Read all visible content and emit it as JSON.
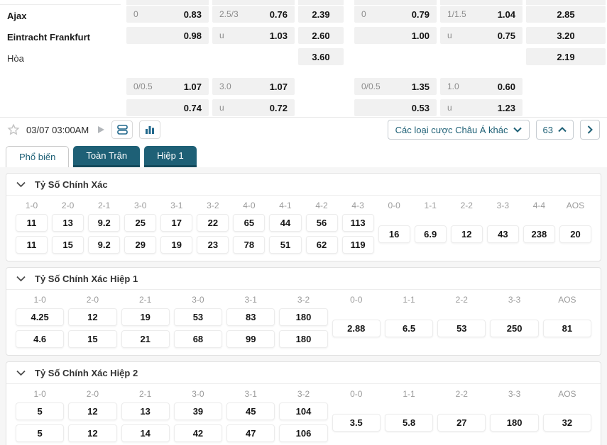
{
  "accent": "#1e6076",
  "odds_board": {
    "teams": [
      "Ajax",
      "Eintracht Frankfurt",
      "Hòa"
    ],
    "main_rows": [
      [
        {
          "h": "0",
          "v": "0.83"
        },
        {
          "h": "2.5/3",
          "v": "0.76"
        },
        {
          "h": "",
          "v": "2.39"
        },
        {
          "h": "0",
          "v": "0.79"
        },
        {
          "h": "1/1.5",
          "v": "1.04"
        },
        {
          "h": "",
          "v": "2.85"
        }
      ],
      [
        {
          "h": "",
          "v": "0.98"
        },
        {
          "h": "u",
          "v": "1.03"
        },
        {
          "h": "",
          "v": "2.60"
        },
        {
          "h": "",
          "v": "1.00"
        },
        {
          "h": "u",
          "v": "0.75"
        },
        {
          "h": "",
          "v": "3.20"
        }
      ],
      [
        null,
        null,
        {
          "h": "",
          "v": "3.60"
        },
        null,
        null,
        {
          "h": "",
          "v": "2.19"
        }
      ]
    ],
    "secondary_rows": [
      [
        {
          "h": "0/0.5",
          "v": "1.07"
        },
        {
          "h": "3.0",
          "v": "1.07"
        },
        null,
        {
          "h": "0/0.5",
          "v": "1.35"
        },
        {
          "h": "1.0",
          "v": "0.60"
        },
        null
      ],
      [
        {
          "h": "",
          "v": "0.74"
        },
        {
          "h": "u",
          "v": "0.72"
        },
        null,
        {
          "h": "",
          "v": "0.53"
        },
        {
          "h": "u",
          "v": "1.23"
        },
        null
      ]
    ]
  },
  "toolbar": {
    "datetime": "03/07 03:00AM",
    "dropdown_label": "Các loại cược Châu Á khác",
    "count": "63"
  },
  "tabs": [
    {
      "label": "Phổ biến",
      "name": "tab-pho-bien",
      "active": true
    },
    {
      "label": "Toàn Trận",
      "name": "tab-toan-tran",
      "active": false
    },
    {
      "label": "Hiệp 1",
      "name": "tab-hiep-1",
      "active": false
    }
  ],
  "panels": [
    {
      "title": "Tỷ Số Chính Xác",
      "columns": [
        "1-0",
        "2-0",
        "2-1",
        "3-0",
        "3-1",
        "3-2",
        "4-0",
        "4-1",
        "4-2",
        "4-3",
        "0-0",
        "1-1",
        "2-2",
        "3-3",
        "4-4",
        "AOS"
      ],
      "split": 10,
      "home": [
        "11",
        "13",
        "9.2",
        "25",
        "17",
        "22",
        "65",
        "44",
        "56",
        "113"
      ],
      "draw": [
        "16",
        "6.9",
        "12",
        "43",
        "238",
        "20"
      ],
      "away": [
        "11",
        "15",
        "9.2",
        "29",
        "19",
        "23",
        "78",
        "51",
        "62",
        "119"
      ]
    },
    {
      "title": "Tỷ Số Chính Xác Hiệp 1",
      "columns": [
        "1-0",
        "2-0",
        "2-1",
        "3-0",
        "3-1",
        "3-2",
        "0-0",
        "1-1",
        "2-2",
        "3-3",
        "AOS"
      ],
      "split": 6,
      "home": [
        "4.25",
        "12",
        "19",
        "53",
        "83",
        "180"
      ],
      "draw": [
        "2.88",
        "6.5",
        "53",
        "250",
        "81"
      ],
      "away": [
        "4.6",
        "15",
        "21",
        "68",
        "99",
        "180"
      ]
    },
    {
      "title": "Tỷ Số Chính Xác Hiệp 2",
      "columns": [
        "1-0",
        "2-0",
        "2-1",
        "3-0",
        "3-1",
        "3-2",
        "0-0",
        "1-1",
        "2-2",
        "3-3",
        "AOS"
      ],
      "split": 6,
      "home": [
        "5",
        "12",
        "13",
        "39",
        "45",
        "104"
      ],
      "draw": [
        "3.5",
        "5.8",
        "27",
        "180",
        "32"
      ],
      "away": [
        "5",
        "12",
        "14",
        "42",
        "47",
        "106"
      ]
    }
  ]
}
